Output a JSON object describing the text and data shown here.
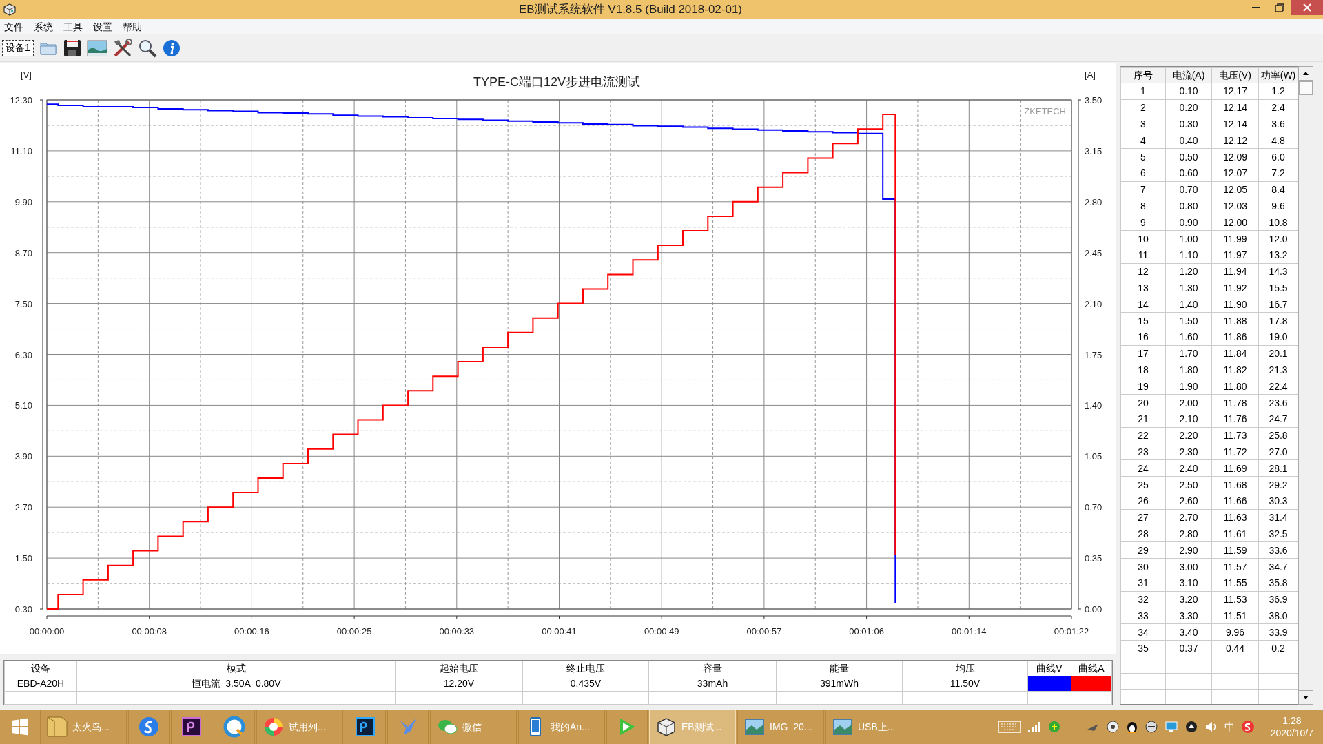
{
  "window": {
    "title": "EB测试系统软件 V1.8.5 (Build 2018-02-01)"
  },
  "menu": [
    "文件",
    "系统",
    "工具",
    "设置",
    "帮助"
  ],
  "toolbar": {
    "device_tab": {
      "label": "设备1",
      "selected": true
    }
  },
  "chart": {
    "title": "TYPE-C端口12V步进电流测试",
    "left_unit": "[V]",
    "right_unit": "[A]",
    "watermark": "ZKETECH",
    "voltage": {
      "chart_data": {
        "type": "line",
        "grid": true,
        "xlim": [
          0,
          82
        ],
        "ylim": [
          0.3,
          12.3
        ],
        "xticks": [
          {
            "value": 0,
            "label": "00:00:00"
          },
          {
            "value": 8.2,
            "label": "00:00:08"
          },
          {
            "value": 16.4,
            "label": "00:00:16"
          },
          {
            "value": 24.6,
            "label": "00:00:25"
          },
          {
            "value": 32.8,
            "label": "00:00:33"
          },
          {
            "value": 41,
            "label": "00:00:41"
          },
          {
            "value": 49.2,
            "label": "00:00:49"
          },
          {
            "value": 57.4,
            "label": "00:00:57"
          },
          {
            "value": 65.6,
            "label": "00:01:06"
          },
          {
            "value": 73.8,
            "label": "00:01:14"
          },
          {
            "value": 82,
            "label": "00:01:22"
          }
        ],
        "yticks": [
          {
            "value": 12.3,
            "label": "12.30"
          },
          {
            "value": 11.1,
            "label": "11.10"
          },
          {
            "value": 9.9,
            "label": "9.90"
          },
          {
            "value": 8.7,
            "label": "8.70"
          },
          {
            "value": 7.5,
            "label": "7.50"
          },
          {
            "value": 6.3,
            "label": "6.30"
          },
          {
            "value": 5.1,
            "label": "5.10"
          },
          {
            "value": 3.9,
            "label": "3.90"
          },
          {
            "value": 2.7,
            "label": "2.70"
          },
          {
            "value": 1.5,
            "label": "1.50"
          },
          {
            "value": 0.3,
            "label": "0.30"
          }
        ],
        "x": [
          0,
          0.9,
          0.9,
          2.9,
          2.9,
          4.9,
          4.9,
          6.9,
          6.9,
          8.9,
          8.9,
          10.9,
          10.9,
          12.9,
          12.9,
          14.9,
          14.9,
          16.9,
          16.9,
          18.9,
          18.9,
          20.9,
          20.9,
          22.9,
          22.9,
          24.9,
          24.9,
          26.9,
          26.9,
          28.9,
          28.9,
          30.9,
          30.9,
          32.9,
          32.9,
          34.9,
          34.9,
          36.9,
          36.9,
          38.9,
          38.9,
          40.9,
          40.9,
          42.9,
          42.9,
          44.9,
          44.9,
          46.9,
          46.9,
          48.9,
          48.9,
          50.9,
          50.9,
          52.9,
          52.9,
          54.9,
          54.9,
          56.9,
          56.9,
          58.9,
          58.9,
          60.9,
          60.9,
          62.9,
          62.9,
          64.9,
          64.9,
          66.9,
          66.9,
          67.9,
          67.9
        ],
        "series": [
          {
            "color": "#0000ff",
            "values": [
              12.2,
              12.2,
              12.17,
              12.17,
              12.14,
              12.14,
              12.14,
              12.14,
              12.12,
              12.12,
              12.09,
              12.09,
              12.07,
              12.07,
              12.05,
              12.05,
              12.03,
              12.03,
              12.0,
              12.0,
              11.99,
              11.99,
              11.97,
              11.97,
              11.94,
              11.94,
              11.92,
              11.92,
              11.9,
              11.9,
              11.88,
              11.88,
              11.86,
              11.86,
              11.84,
              11.84,
              11.82,
              11.82,
              11.8,
              11.8,
              11.78,
              11.78,
              11.76,
              11.76,
              11.73,
              11.73,
              11.72,
              11.72,
              11.69,
              11.69,
              11.68,
              11.68,
              11.66,
              11.66,
              11.63,
              11.63,
              11.61,
              11.61,
              11.59,
              11.59,
              11.57,
              11.57,
              11.55,
              11.55,
              11.53,
              11.53,
              11.51,
              11.51,
              9.96,
              9.96,
              0.44
            ]
          }
        ]
      }
    },
    "current": {
      "chart_data": {
        "type": "line",
        "xlim": [
          0,
          82
        ],
        "ylim": [
          0,
          3.5
        ],
        "yticks": [
          {
            "value": 3.5,
            "label": "3.50"
          },
          {
            "value": 3.15,
            "label": "3.15"
          },
          {
            "value": 2.8,
            "label": "2.80"
          },
          {
            "value": 2.45,
            "label": "2.45"
          },
          {
            "value": 2.1,
            "label": "2.10"
          },
          {
            "value": 1.75,
            "label": "1.75"
          },
          {
            "value": 1.4,
            "label": "1.40"
          },
          {
            "value": 1.05,
            "label": "1.05"
          },
          {
            "value": 0.7,
            "label": "0.70"
          },
          {
            "value": 0.35,
            "label": "0.35"
          },
          {
            "value": 0,
            "label": "0.00"
          }
        ],
        "x": [
          0,
          0.9,
          0.9,
          2.9,
          2.9,
          4.9,
          4.9,
          6.9,
          6.9,
          8.9,
          8.9,
          10.9,
          10.9,
          12.9,
          12.9,
          14.9,
          14.9,
          16.9,
          16.9,
          18.9,
          18.9,
          20.9,
          20.9,
          22.9,
          22.9,
          24.9,
          24.9,
          26.9,
          26.9,
          28.9,
          28.9,
          30.9,
          30.9,
          32.9,
          32.9,
          34.9,
          34.9,
          36.9,
          36.9,
          38.9,
          38.9,
          40.9,
          40.9,
          42.9,
          42.9,
          44.9,
          44.9,
          46.9,
          46.9,
          48.9,
          48.9,
          50.9,
          50.9,
          52.9,
          52.9,
          54.9,
          54.9,
          56.9,
          56.9,
          58.9,
          58.9,
          60.9,
          60.9,
          62.9,
          62.9,
          64.9,
          64.9,
          66.9,
          66.9,
          67.9,
          67.9
        ],
        "series": [
          {
            "color": "#ff0000",
            "values": [
              0,
              0,
              0.1,
              0.1,
              0.2,
              0.2,
              0.3,
              0.3,
              0.4,
              0.4,
              0.5,
              0.5,
              0.6,
              0.6,
              0.7,
              0.7,
              0.8,
              0.8,
              0.9,
              0.9,
              1.0,
              1.0,
              1.1,
              1.1,
              1.2,
              1.2,
              1.3,
              1.3,
              1.4,
              1.4,
              1.5,
              1.5,
              1.6,
              1.6,
              1.7,
              1.7,
              1.8,
              1.8,
              1.9,
              1.9,
              2.0,
              2.0,
              2.1,
              2.1,
              2.2,
              2.2,
              2.3,
              2.3,
              2.4,
              2.4,
              2.5,
              2.5,
              2.6,
              2.6,
              2.7,
              2.7,
              2.8,
              2.8,
              2.9,
              2.9,
              3.0,
              3.0,
              3.1,
              3.1,
              3.2,
              3.2,
              3.3,
              3.3,
              3.4,
              3.4,
              0.37
            ]
          }
        ]
      }
    }
  },
  "summary": {
    "columns": [
      "设备",
      "模式",
      "起始电压",
      "终止电压",
      "容量",
      "能量",
      "均压",
      "曲线V",
      "曲线A"
    ],
    "row": {
      "device": "EBD-A20H",
      "mode": "恒电流  3.50A  0.80V",
      "start_voltage": "12.20V",
      "end_voltage": "0.435V",
      "capacity": "33mAh",
      "energy": "391mWh",
      "avg_voltage": "11.50V",
      "curve_v": {
        "color": "#0000ff"
      },
      "curve_a": {
        "color": "#ff0000"
      }
    }
  },
  "readings": {
    "columns": [
      "序号",
      "电流(A)",
      "电压(V)",
      "功率(W)"
    ],
    "rows": [
      [
        "1",
        "0.10",
        "12.17",
        "1.2"
      ],
      [
        "2",
        "0.20",
        "12.14",
        "2.4"
      ],
      [
        "3",
        "0.30",
        "12.14",
        "3.6"
      ],
      [
        "4",
        "0.40",
        "12.12",
        "4.8"
      ],
      [
        "5",
        "0.50",
        "12.09",
        "6.0"
      ],
      [
        "6",
        "0.60",
        "12.07",
        "7.2"
      ],
      [
        "7",
        "0.70",
        "12.05",
        "8.4"
      ],
      [
        "8",
        "0.80",
        "12.03",
        "9.6"
      ],
      [
        "9",
        "0.90",
        "12.00",
        "10.8"
      ],
      [
        "10",
        "1.00",
        "11.99",
        "12.0"
      ],
      [
        "11",
        "1.10",
        "11.97",
        "13.2"
      ],
      [
        "12",
        "1.20",
        "11.94",
        "14.3"
      ],
      [
        "13",
        "1.30",
        "11.92",
        "15.5"
      ],
      [
        "14",
        "1.40",
        "11.90",
        "16.7"
      ],
      [
        "15",
        "1.50",
        "11.88",
        "17.8"
      ],
      [
        "16",
        "1.60",
        "11.86",
        "19.0"
      ],
      [
        "17",
        "1.70",
        "11.84",
        "20.1"
      ],
      [
        "18",
        "1.80",
        "11.82",
        "21.3"
      ],
      [
        "19",
        "1.90",
        "11.80",
        "22.4"
      ],
      [
        "20",
        "2.00",
        "11.78",
        "23.6"
      ],
      [
        "21",
        "2.10",
        "11.76",
        "24.7"
      ],
      [
        "22",
        "2.20",
        "11.73",
        "25.8"
      ],
      [
        "23",
        "2.30",
        "11.72",
        "27.0"
      ],
      [
        "24",
        "2.40",
        "11.69",
        "28.1"
      ],
      [
        "25",
        "2.50",
        "11.68",
        "29.2"
      ],
      [
        "26",
        "2.60",
        "11.66",
        "30.3"
      ],
      [
        "27",
        "2.70",
        "11.63",
        "31.4"
      ],
      [
        "28",
        "2.80",
        "11.61",
        "32.5"
      ],
      [
        "29",
        "2.90",
        "11.59",
        "33.6"
      ],
      [
        "30",
        "3.00",
        "11.57",
        "34.7"
      ],
      [
        "31",
        "3.10",
        "11.55",
        "35.8"
      ],
      [
        "32",
        "3.20",
        "11.53",
        "36.9"
      ],
      [
        "33",
        "3.30",
        "11.51",
        "38.0"
      ],
      [
        "34",
        "3.40",
        "9.96",
        "33.9"
      ],
      [
        "35",
        "0.37",
        "0.44",
        "0.2"
      ]
    ]
  },
  "taskbar": {
    "items": [
      {
        "label": "太火鸟...",
        "selected": false
      },
      {
        "selected": false
      },
      {
        "selected": false
      },
      {
        "selected": false
      },
      {
        "label": "试用列...",
        "selected": false
      },
      {
        "selected": false
      },
      {
        "selected": false
      },
      {
        "label": "微信",
        "selected": false
      },
      {
        "label": "我的An...",
        "selected": false
      },
      {
        "selected": false
      },
      {
        "label": "EB测试...",
        "selected": true
      },
      {
        "label": "IMG_20...",
        "selected": false
      },
      {
        "label": "USB上...",
        "selected": false
      }
    ],
    "ime": "中",
    "time": "1:28",
    "date": "2020/10/7"
  }
}
